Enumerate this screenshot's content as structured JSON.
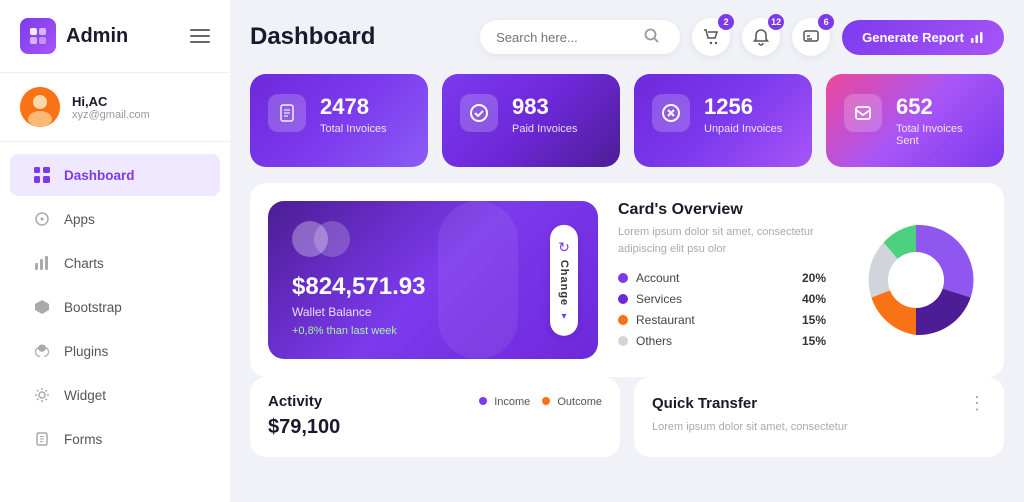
{
  "sidebar": {
    "logo_text": "Admin",
    "logo_icon": "⬡",
    "user": {
      "name": "Hi,AC",
      "email": "xyz@gmail.com",
      "initials": "AC"
    },
    "nav_items": [
      {
        "id": "dashboard",
        "label": "Dashboard",
        "icon": "⊞",
        "active": true
      },
      {
        "id": "apps",
        "label": "Apps",
        "icon": "ℹ",
        "active": false
      },
      {
        "id": "charts",
        "label": "Charts",
        "icon": "⊠",
        "active": false
      },
      {
        "id": "bootstrap",
        "label": "Bootstrap",
        "icon": "★",
        "active": false
      },
      {
        "id": "plugins",
        "label": "Plugins",
        "icon": "♥",
        "active": false
      },
      {
        "id": "widget",
        "label": "Widget",
        "icon": "⚙",
        "active": false
      },
      {
        "id": "forms",
        "label": "Forms",
        "icon": "🖨",
        "active": false
      }
    ]
  },
  "header": {
    "page_title": "Dashboard",
    "search_placeholder": "Search here...",
    "badges": {
      "cart": "2",
      "bell": "12",
      "message": "6"
    },
    "generate_btn": "Generate Report"
  },
  "stat_cards": [
    {
      "id": "total-invoices",
      "value": "2478",
      "label": "Total Invoices",
      "icon": "📋"
    },
    {
      "id": "paid-invoices",
      "value": "983",
      "label": "Paid Invoices",
      "icon": "✅"
    },
    {
      "id": "unpaid-invoices",
      "value": "1256",
      "label": "Unpaid Invoices",
      "icon": "✖"
    },
    {
      "id": "sent-invoices",
      "value": "652",
      "label": "Total Invoices Sent",
      "icon": "📤"
    }
  ],
  "wallet": {
    "amount": "$824,571.93",
    "label": "Wallet Balance",
    "change": "+0,8% than last week",
    "change_btn": "Change"
  },
  "card_overview": {
    "title": "Card's Overview",
    "description": "Lorem ipsum dolor sit amet, consectetur adipiscing elit psu olor",
    "legend": [
      {
        "label": "Account",
        "pct": "20%",
        "color": "#7c3aed"
      },
      {
        "label": "Services",
        "pct": "40%",
        "color": "#6d28d9"
      },
      {
        "label": "Restaurant",
        "pct": "15%",
        "color": "#f97316"
      },
      {
        "label": "Others",
        "pct": "15%",
        "color": "#d1d5db"
      }
    ]
  },
  "activity": {
    "title": "Activity",
    "income_label": "Income",
    "outcome_label": "Outcome",
    "value": "$79,100",
    "income_color": "#7c3aed",
    "outcome_color": "#f97316"
  },
  "quick_transfer": {
    "title": "Quick Transfer",
    "description": "Lorem ipsum dolor sit amet, consectetur",
    "dots_icon": "⋮"
  }
}
